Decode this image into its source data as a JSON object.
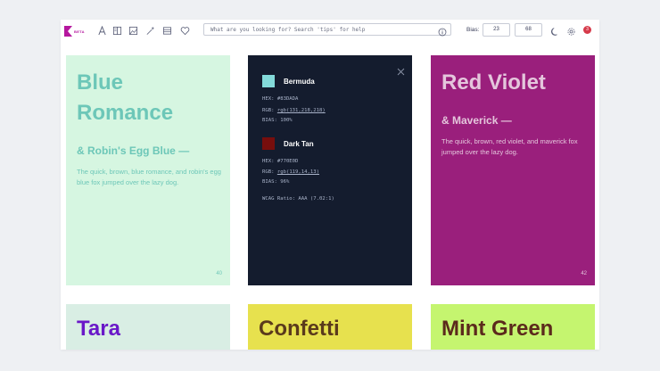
{
  "toolbar": {
    "logo_badge": "BETA",
    "icons": [
      "font-icon",
      "columns-icon",
      "image-icon",
      "wand-icon",
      "list-icon",
      "heart-icon"
    ],
    "search_placeholder": "What are you looking for? Search 'tips' for help",
    "bias_label": "Bias:",
    "bias_value_1": "23",
    "bias_value_2": "68",
    "notification_count": "3"
  },
  "cards": [
    {
      "title": "Blue Romance",
      "subtitle": "& Robin's Egg Blue —",
      "description": "The quick, brown, blue romance, and robin's egg blue fox jumped over the lazy dog.",
      "number": "40",
      "bg": "#d6f6e1",
      "fg": "#6dc7b8"
    },
    {
      "color1": {
        "name": "Bermuda",
        "hex": "HEX: #83DADA",
        "rgb_label": "RGB: ",
        "rgb_value": "rgb(131,218,218)",
        "bias": "BIAS: 100%",
        "swatch": "#83dada"
      },
      "color2": {
        "name": "Dark Tan",
        "hex": "HEX: #770E0D",
        "rgb_label": "RGB: ",
        "rgb_value": "rgb(119,14,13)",
        "bias": "BIAS: 96%",
        "swatch": "#770e0d"
      },
      "wcag": "WCAG Ratio: AAA (7.02:1)",
      "bg": "#141c2e"
    },
    {
      "title": "Red Violet",
      "subtitle": "& Maverick —",
      "description": "The quick, brown, red violet, and maverick fox jumped over the lazy dog.",
      "number": "42",
      "bg": "#9a1f7c",
      "fg": "#e4c6dc"
    },
    {
      "title": "Tara",
      "bg": "#d9eee4",
      "fg": "#6a18c8"
    },
    {
      "title": "Confetti",
      "bg": "#e7e14e",
      "fg": "#5a3a1c"
    },
    {
      "title": "Mint Green",
      "bg": "#c5f56f",
      "fg": "#5b2a1c"
    }
  ]
}
